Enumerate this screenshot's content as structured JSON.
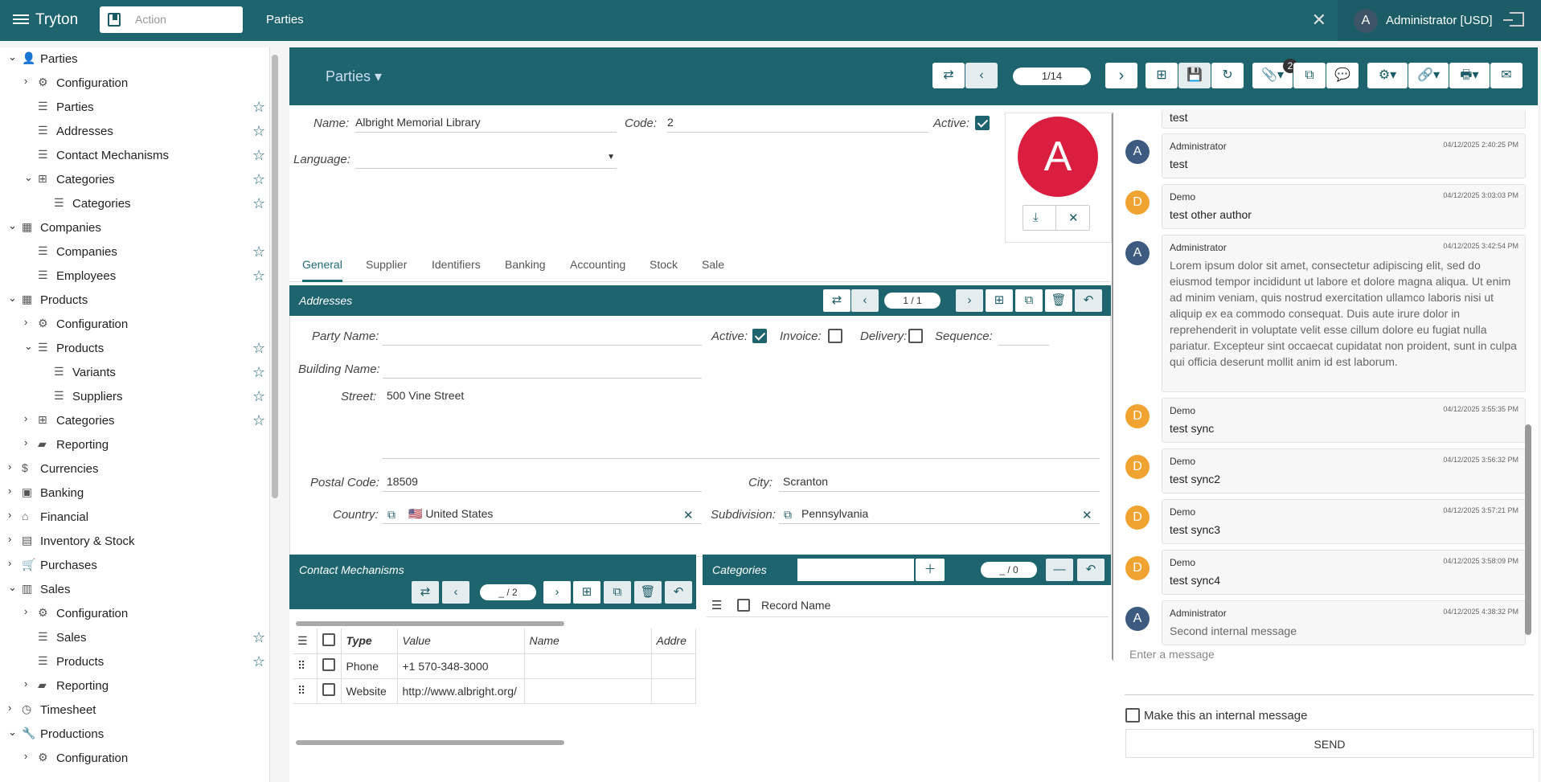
{
  "app": {
    "brand": "Tryton",
    "action_placeholder": "Action",
    "tab_title": "Parties",
    "user": "Administrator [USD]",
    "user_initial": "A"
  },
  "sidebar": {
    "items": [
      {
        "label": "Parties",
        "level": 0,
        "expanded": true,
        "icon": "person-icon"
      },
      {
        "label": "Configuration",
        "level": 1,
        "expanded": false,
        "icon": "gear-icon"
      },
      {
        "label": "Parties",
        "level": 1,
        "icon": "list-icon",
        "star": true
      },
      {
        "label": "Addresses",
        "level": 1,
        "icon": "list-icon",
        "star": true
      },
      {
        "label": "Contact Mechanisms",
        "level": 1,
        "icon": "list-icon",
        "star": true
      },
      {
        "label": "Categories",
        "level": 1,
        "expanded": true,
        "icon": "tree-icon",
        "star": true
      },
      {
        "label": "Categories",
        "level": 2,
        "icon": "list-icon",
        "star": true
      },
      {
        "label": "Companies",
        "level": 0,
        "expanded": true,
        "icon": "company-icon"
      },
      {
        "label": "Companies",
        "level": 1,
        "icon": "list-icon",
        "star": true
      },
      {
        "label": "Employees",
        "level": 1,
        "icon": "list-icon",
        "star": true
      },
      {
        "label": "Products",
        "level": 0,
        "expanded": true,
        "icon": "grid-icon"
      },
      {
        "label": "Configuration",
        "level": 1,
        "expanded": false,
        "icon": "gear-icon"
      },
      {
        "label": "Products",
        "level": 1,
        "expanded": true,
        "icon": "list-icon",
        "star": true
      },
      {
        "label": "Variants",
        "level": 2,
        "icon": "list-icon",
        "star": true
      },
      {
        "label": "Suppliers",
        "level": 2,
        "icon": "list-icon",
        "star": true
      },
      {
        "label": "Categories",
        "level": 1,
        "expanded": false,
        "icon": "tree-icon",
        "star": true
      },
      {
        "label": "Reporting",
        "level": 1,
        "expanded": false,
        "icon": "folder-icon"
      },
      {
        "label": "Currencies",
        "level": 0,
        "expanded": false,
        "icon": "dollar-icon"
      },
      {
        "label": "Banking",
        "level": 0,
        "expanded": false,
        "icon": "bank-card-icon"
      },
      {
        "label": "Financial",
        "level": 0,
        "expanded": false,
        "icon": "bank-icon"
      },
      {
        "label": "Inventory & Stock",
        "level": 0,
        "expanded": false,
        "icon": "inventory-icon"
      },
      {
        "label": "Purchases",
        "level": 0,
        "expanded": false,
        "icon": "cart-icon"
      },
      {
        "label": "Sales",
        "level": 0,
        "expanded": true,
        "icon": "sales-icon"
      },
      {
        "label": "Configuration",
        "level": 1,
        "expanded": false,
        "icon": "gear-icon"
      },
      {
        "label": "Sales",
        "level": 1,
        "icon": "list-icon",
        "star": true
      },
      {
        "label": "Products",
        "level": 1,
        "icon": "list-icon",
        "star": true
      },
      {
        "label": "Reporting",
        "level": 1,
        "expanded": false,
        "icon": "folder-icon"
      },
      {
        "label": "Timesheet",
        "level": 0,
        "expanded": false,
        "icon": "timer-icon"
      },
      {
        "label": "Productions",
        "level": 0,
        "expanded": true,
        "icon": "wrench-icon"
      },
      {
        "label": "Configuration",
        "level": 1,
        "expanded": false,
        "icon": "gear-icon"
      }
    ]
  },
  "form": {
    "title": "Parties",
    "record_pager": "1/14",
    "attachment_count": "2",
    "name_label": "Name:",
    "name_value": "Albright Memorial Library",
    "code_label": "Code:",
    "code_value": "2",
    "active_label": "Active:",
    "active_checked": true,
    "language_label": "Language:",
    "avatar_letter": "A",
    "avatar_color": "#d91e3f",
    "tabs": [
      "General",
      "Supplier",
      "Identifiers",
      "Banking",
      "Accounting",
      "Stock",
      "Sale"
    ]
  },
  "addresses": {
    "title": "Addresses",
    "pager": "1 / 1",
    "party_name_label": "Party Name:",
    "party_name_value": "",
    "active_label": "Active:",
    "invoice_label": "Invoice:",
    "delivery_label": "Delivery:",
    "sequence_label": "Sequence:",
    "building_label": "Building Name:",
    "street_label": "Street:",
    "street_value": "500 Vine Street",
    "postal_label": "Postal Code:",
    "postal_value": "18509",
    "city_label": "City:",
    "city_value": "Scranton",
    "country_label": "Country:",
    "country_value": "🇺🇸 United States",
    "subdivision_label": "Subdivision:",
    "subdivision_value": "Pennsylvania"
  },
  "contacts": {
    "title": "Contact Mechanisms",
    "pager": "_ / 2",
    "columns": [
      "Type",
      "Value",
      "Name",
      "Addre"
    ],
    "rows": [
      {
        "type": "Phone",
        "value": "+1 570-348-3000",
        "name": ""
      },
      {
        "type": "Website",
        "value": "http://www.albright.org/",
        "name": ""
      }
    ]
  },
  "categories": {
    "title": "Categories",
    "pager": "_ / 0",
    "column": "Record Name"
  },
  "chat": {
    "top_text": "test",
    "messages": [
      {
        "author": "Administrator",
        "initial": "A",
        "date": "04/12/2025 2:40:25 PM",
        "text": "test"
      },
      {
        "author": "Demo",
        "initial": "D",
        "date": "04/12/2025 3:03:03 PM",
        "text": "test other author"
      },
      {
        "author": "Administrator",
        "initial": "A",
        "date": "04/12/2025 3:42:54 PM",
        "text": "Lorem ipsum dolor sit amet, consectetur adipiscing elit, sed do eiusmod tempor incididunt ut labore et dolore magna aliqua. Ut enim ad minim veniam, quis nostrud exercitation ullamco laboris nisi ut aliquip ex ea commodo consequat. Duis aute irure dolor in reprehenderit in voluptate velit esse cillum dolore eu fugiat nulla pariatur. Excepteur sint occaecat cupidatat non proident, sunt in culpa qui officia deserunt mollit anim id est laborum."
      },
      {
        "author": "Demo",
        "initial": "D",
        "date": "04/12/2025 3:55:35 PM",
        "text": "test sync"
      },
      {
        "author": "Demo",
        "initial": "D",
        "date": "04/12/2025 3:56:32 PM",
        "text": "test sync2"
      },
      {
        "author": "Demo",
        "initial": "D",
        "date": "04/12/2025 3:57:21 PM",
        "text": "test sync3"
      },
      {
        "author": "Demo",
        "initial": "D",
        "date": "04/12/2025 3:58:09 PM",
        "text": "test sync4"
      },
      {
        "author": "Administrator",
        "initial": "A",
        "date": "04/12/2025 4:38:32 PM",
        "text": "Second internal message"
      }
    ],
    "input_placeholder": "Enter a message",
    "internal_label": "Make this an internal message",
    "send_label": "SEND"
  }
}
